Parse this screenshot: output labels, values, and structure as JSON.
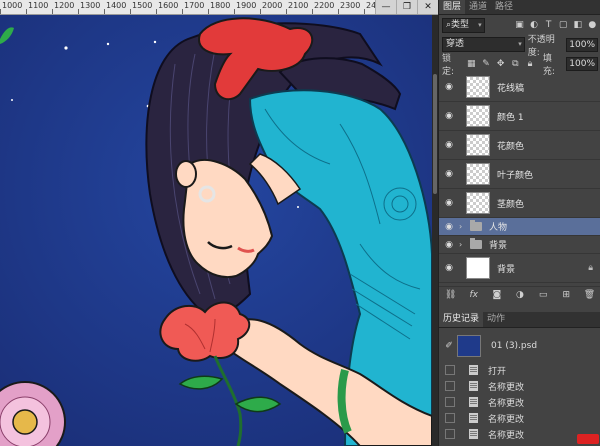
{
  "ruler": {
    "numbers": [
      "1000",
      "1100",
      "1200",
      "1300",
      "1400",
      "1500",
      "1600",
      "1700",
      "1800",
      "1900",
      "2000",
      "2100",
      "2200",
      "2300",
      "2400",
      "2500"
    ]
  },
  "window": {
    "minimize": "—",
    "restore": "❐",
    "close": "✕"
  },
  "panels": {
    "layers_tabs": [
      "图层",
      "通道",
      "路径"
    ],
    "filter_kind": "类型",
    "blend_mode": "穿透",
    "opacity_label": "不透明度:",
    "opacity_value": "100%",
    "lock_label": "锁定:",
    "fill_label": "填充:",
    "fill_value": "100%",
    "layers": [
      {
        "name": "花线稿",
        "type": "layer",
        "visible": true
      },
      {
        "name": "颜色 1",
        "type": "layer",
        "visible": true
      },
      {
        "name": "花颜色",
        "type": "layer",
        "visible": true
      },
      {
        "name": "叶子颜色",
        "type": "layer",
        "visible": true
      },
      {
        "name": "茎颜色",
        "type": "layer",
        "visible": true
      },
      {
        "name": "人物",
        "type": "group",
        "visible": true,
        "selected": true
      },
      {
        "name": "背景",
        "type": "group",
        "visible": true
      },
      {
        "name": "背景",
        "type": "layer",
        "visible": true,
        "locked": true
      }
    ],
    "history_tabs": [
      "历史记录",
      "动作"
    ],
    "history_snapshot": "01 (3).psd",
    "history_items": [
      "打开",
      "名称更改",
      "名称更改",
      "名称更改",
      "名称更改"
    ]
  },
  "colors": {
    "canvas_bg": "#1f3a8a",
    "panel_bg": "#434343",
    "selected_layer": "#5a6f9a"
  }
}
